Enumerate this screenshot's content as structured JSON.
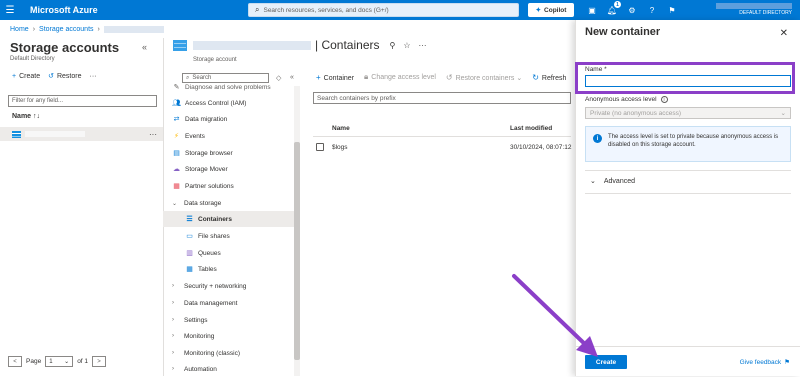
{
  "topbar": {
    "brand": "Microsoft Azure",
    "search_placeholder": "Search resources, services, and docs (G+/)",
    "copilot_label": "Copilot",
    "notification_count": "1",
    "directory": "DEFAULT DIRECTORY"
  },
  "breadcrumb": {
    "home": "Home",
    "storage_accounts": "Storage accounts"
  },
  "left": {
    "title": "Storage accounts",
    "subtitle": "Default Directory",
    "create": "Create",
    "restore": "Restore",
    "filter_placeholder": "Filter for any field...",
    "name_header": "Name",
    "page_label": "Page",
    "page_value": "1",
    "of_label": "of 1"
  },
  "storage_account": {
    "page_title": "| Containers",
    "type_label": "Storage account"
  },
  "resource_menu": {
    "search_placeholder": "Search",
    "cut_item": "Diagnose and solve problems",
    "items": [
      {
        "label": "Access Control (IAM)",
        "icon": "people-icon"
      },
      {
        "label": "Data migration",
        "icon": "migration-icon"
      },
      {
        "label": "Events",
        "icon": "lightning-icon"
      },
      {
        "label": "Storage browser",
        "icon": "storage-browser-icon"
      },
      {
        "label": "Storage Mover",
        "icon": "storage-mover-icon"
      },
      {
        "label": "Partner solutions",
        "icon": "partner-icon"
      },
      {
        "label": "Data storage",
        "icon": "chevron-down-icon"
      },
      {
        "label": "Containers",
        "icon": "containers-icon"
      },
      {
        "label": "File shares",
        "icon": "file-shares-icon"
      },
      {
        "label": "Queues",
        "icon": "queues-icon"
      },
      {
        "label": "Tables",
        "icon": "tables-icon"
      },
      {
        "label": "Security + networking",
        "icon": "chevron-right-icon"
      },
      {
        "label": "Data management",
        "icon": "chevron-right-icon"
      },
      {
        "label": "Settings",
        "icon": "chevron-right-icon"
      },
      {
        "label": "Monitoring",
        "icon": "chevron-right-icon"
      },
      {
        "label": "Monitoring (classic)",
        "icon": "chevron-right-icon"
      },
      {
        "label": "Automation",
        "icon": "chevron-right-icon"
      }
    ]
  },
  "containers": {
    "add_container": "Container",
    "change_access": "Change access level",
    "restore": "Restore containers",
    "refresh": "Refresh",
    "search_placeholder": "Search containers by prefix",
    "col_name": "Name",
    "col_modified": "Last modified",
    "rows": [
      {
        "name": "$logs",
        "modified": "30/10/2024, 08:07:12"
      }
    ]
  },
  "blade": {
    "title": "New container",
    "name_label": "Name *",
    "name_value": "",
    "access_label": "Anonymous access level",
    "access_value": "Private (no anonymous access)",
    "info_text": "The access level is set to private because anonymous access is disabled on this storage account.",
    "advanced": "Advanced",
    "create": "Create",
    "feedback": "Give feedback"
  },
  "colors": {
    "brand": "#0078d4",
    "annotation": "#8b3fc8"
  }
}
